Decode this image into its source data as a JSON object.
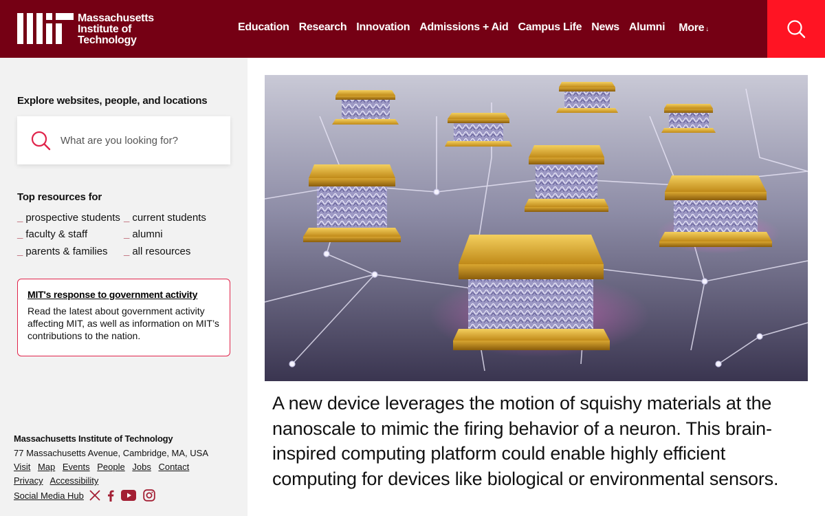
{
  "header": {
    "logo_text": [
      "Massachusetts",
      "Institute of",
      "Technology"
    ],
    "nav": [
      "Education",
      "Research",
      "Innovation",
      "Admissions + Aid",
      "Campus Life",
      "News",
      "Alumni"
    ],
    "more_label": "More",
    "more_arrow": "↓",
    "colors": {
      "header_bg": "#750014",
      "search_bg": "#ff1423"
    }
  },
  "sidebar": {
    "explore_title": "Explore websites, people, and locations",
    "search_placeholder": "What are you looking for?",
    "resources_title": "Top resources for",
    "resources": [
      "prospective students",
      "current students",
      "faculty & staff",
      "alumni",
      "parents & families",
      "all resources"
    ],
    "alert": {
      "title": "MIT's response to government activity",
      "body": "Read the latest about government activity affecting MIT, as well as information on MIT’s contributions to the nation."
    },
    "footer": {
      "org": "Massachusetts Institute of Technology",
      "address": "77 Massachusetts Avenue, Cambridge, MA, USA",
      "links": [
        "Visit",
        "Map",
        "Events",
        "People",
        "Jobs",
        "Contact",
        "Privacy",
        "Accessibility"
      ],
      "social_hub": "Social Media Hub",
      "social_icons": [
        "x-icon",
        "facebook-icon",
        "youtube-icon",
        "instagram-icon"
      ]
    }
  },
  "main": {
    "caption": "A new device leverages the motion of squishy materials at the nanoscale to mimic the firing behavior of a neuron. This brain-inspired computing platform could enable highly efficient computing for devices like biological or environmental sensors."
  }
}
